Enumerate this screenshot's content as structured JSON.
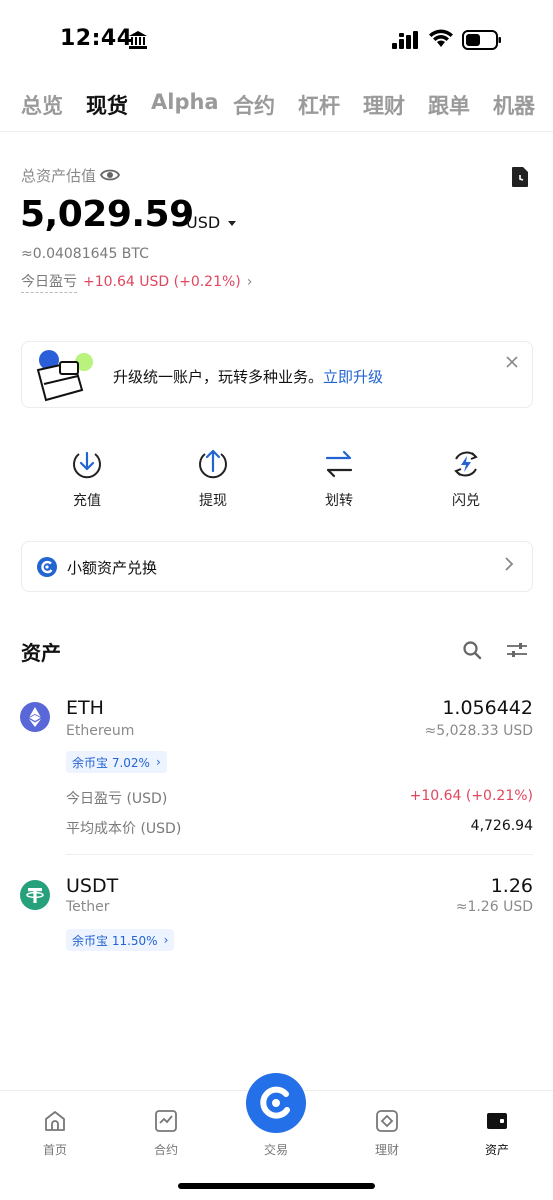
{
  "status_bar": {
    "time": "12:44"
  },
  "tabs": [
    {
      "label": "总览",
      "active": false
    },
    {
      "label": "现货",
      "active": true
    },
    {
      "label": "Alpha",
      "active": false
    },
    {
      "label": "合约",
      "active": false
    },
    {
      "label": "杠杆",
      "active": false
    },
    {
      "label": "理财",
      "active": false
    },
    {
      "label": "跟单",
      "active": false
    },
    {
      "label": "机器",
      "active": false
    }
  ],
  "overview": {
    "label": "总资产估值",
    "total_value": "5,029.59",
    "currency": "USD",
    "btc_equivalent": "≈0.04081645 BTC",
    "pnl_label": "今日盈亏",
    "pnl_value": "+10.64 USD (+0.21%)"
  },
  "banner": {
    "text": "升级统一账户，玩转多种业务。",
    "link": "立即升级"
  },
  "actions": [
    {
      "label": "充值",
      "icon": "deposit-icon"
    },
    {
      "label": "提现",
      "icon": "withdraw-icon"
    },
    {
      "label": "划转",
      "icon": "transfer-icon"
    },
    {
      "label": "闪兑",
      "icon": "convert-icon"
    }
  ],
  "small_assets": {
    "label": "小额资产兑换"
  },
  "assets": {
    "title": "资产",
    "items": [
      {
        "symbol": "ETH",
        "name": "Ethereum",
        "amount": "1.056442",
        "fiat": "≈5,028.33 USD",
        "earn_badge": "余币宝 7.02%",
        "pnl_label": "今日盈亏 (USD)",
        "pnl_value": "+10.64 (+0.21%)",
        "cost_label": "平均成本价 (USD)",
        "cost_value": "4,726.94"
      },
      {
        "symbol": "USDT",
        "name": "Tether",
        "amount": "1.26",
        "fiat": "≈1.26 USD",
        "earn_badge": "余币宝 11.50%"
      }
    ]
  },
  "bottom_nav": [
    {
      "label": "首页",
      "icon": "home-icon"
    },
    {
      "label": "合约",
      "icon": "futures-icon"
    },
    {
      "label": "交易",
      "icon": "trade-icon"
    },
    {
      "label": "理财",
      "icon": "earn-icon"
    },
    {
      "label": "资产",
      "icon": "wallet-icon",
      "active": true
    }
  ],
  "colors": {
    "accent": "#2470e8",
    "link": "#2264d1",
    "negative_red": "#e0465e",
    "eth": "#5a67d8",
    "usdt": "#26a17b"
  }
}
